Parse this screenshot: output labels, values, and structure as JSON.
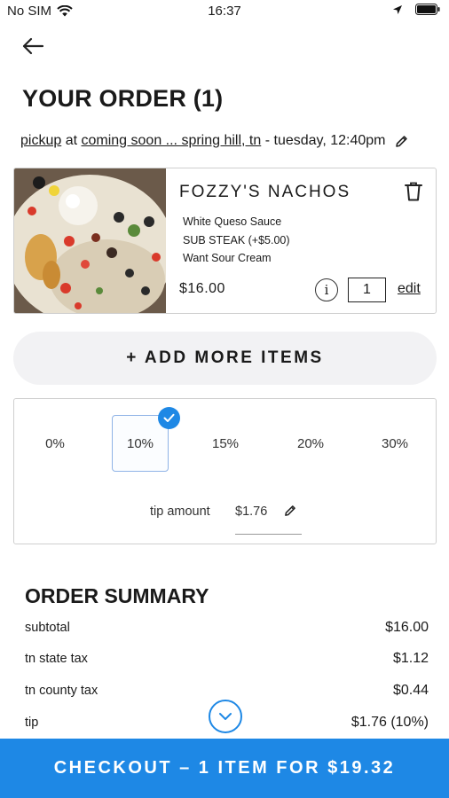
{
  "status_bar": {
    "carrier": "No SIM",
    "time": "16:37"
  },
  "header": {
    "title": "YOUR ORDER (1)"
  },
  "order_meta": {
    "method": "pickup",
    "at": "at",
    "location": "coming soon ... spring hill, tn",
    "separator": "-",
    "when": "tuesday, 12:40pm"
  },
  "cart_item": {
    "name": "FOZZY'S NACHOS",
    "modifiers": [
      "White Queso Sauce",
      "SUB STEAK (+$5.00)",
      "Want Sour Cream"
    ],
    "price": "$16.00",
    "info_glyph": "i",
    "quantity": "1",
    "edit_label": "edit"
  },
  "add_more": {
    "label": "+ ADD MORE ITEMS"
  },
  "tip": {
    "options": [
      "0%",
      "10%",
      "15%",
      "20%",
      "30%"
    ],
    "selected_index": 1,
    "amount_label": "tip amount",
    "amount_value": "$1.76"
  },
  "summary": {
    "title": "ORDER SUMMARY",
    "rows": [
      {
        "label": "subtotal",
        "value": "$16.00"
      },
      {
        "label": "tn state tax",
        "value": "$1.12"
      },
      {
        "label": "tn county tax",
        "value": "$0.44"
      },
      {
        "label": "tip",
        "value": "$1.76 (10%)"
      }
    ]
  },
  "checkout": {
    "label": "CHECKOUT – 1 ITEM FOR $19.32"
  },
  "icons": {
    "back": "arrow-left-icon",
    "meta_edit": "pencil-icon",
    "trash": "trash-icon",
    "info": "info-icon",
    "check": "check-icon",
    "tip_edit": "pencil-icon",
    "scroll": "chevron-down-icon",
    "wifi": "wifi-icon",
    "location": "location-arrow-icon",
    "battery": "battery-icon"
  },
  "colors": {
    "accent": "#1e88e5",
    "add_more_bg": "#f2f2f4"
  }
}
